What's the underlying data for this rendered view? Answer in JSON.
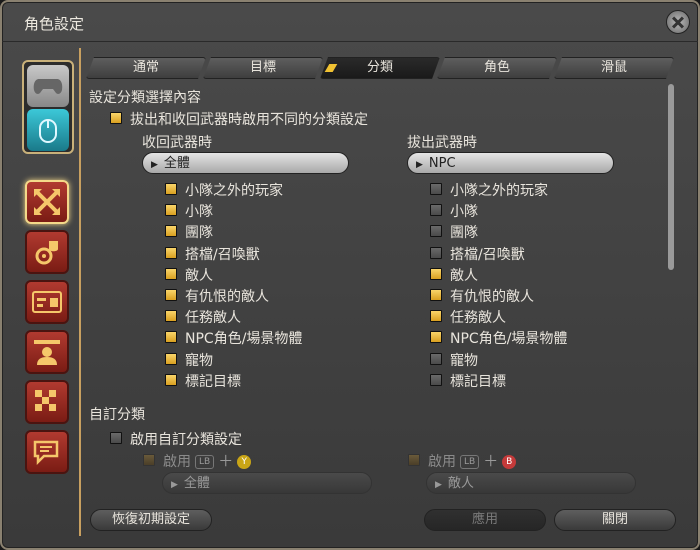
{
  "window": {
    "title": "角色設定"
  },
  "tabs": [
    {
      "label": "通常",
      "active": false
    },
    {
      "label": "目標",
      "active": false
    },
    {
      "label": "分類",
      "active": true
    },
    {
      "label": "角色",
      "active": false
    },
    {
      "label": "滑鼠",
      "active": false
    }
  ],
  "sidebar": {
    "modes": [
      "gamepad-icon",
      "mouse-icon"
    ],
    "categories": [
      "crossed-swords-icon",
      "gear-pouch-icon",
      "id-card-icon",
      "person-icon",
      "checker-icon",
      "chat-bubble-icon"
    ]
  },
  "section1": {
    "heading": "設定分類選擇內容",
    "toggle_label": "拔出和收回武器時啟用不同的分類設定",
    "toggle_checked": true,
    "left": {
      "header": "收回武器時",
      "dropdown": "全體",
      "items": [
        {
          "label": "小隊之外的玩家",
          "checked": true
        },
        {
          "label": "小隊",
          "checked": true
        },
        {
          "label": "團隊",
          "checked": true
        },
        {
          "label": "搭檔/召喚獸",
          "checked": true
        },
        {
          "label": "敵人",
          "checked": true
        },
        {
          "label": "有仇恨的敵人",
          "checked": true
        },
        {
          "label": "任務敵人",
          "checked": true
        },
        {
          "label": "NPC角色/場景物體",
          "checked": true
        },
        {
          "label": "寵物",
          "checked": true
        },
        {
          "label": "標記目標",
          "checked": true
        }
      ]
    },
    "right": {
      "header": "拔出武器時",
      "dropdown": "NPC",
      "items": [
        {
          "label": "小隊之外的玩家",
          "checked": false
        },
        {
          "label": "小隊",
          "checked": false
        },
        {
          "label": "團隊",
          "checked": false
        },
        {
          "label": "搭檔/召喚獸",
          "checked": false
        },
        {
          "label": "敵人",
          "checked": true
        },
        {
          "label": "有仇恨的敵人",
          "checked": true
        },
        {
          "label": "任務敵人",
          "checked": true
        },
        {
          "label": "NPC角色/場景物體",
          "checked": true
        },
        {
          "label": "寵物",
          "checked": false
        },
        {
          "label": "標記目標",
          "checked": false
        }
      ]
    }
  },
  "section2": {
    "heading": "自訂分類",
    "toggle_label": "啟用自訂分類設定",
    "toggle_checked": false,
    "left": {
      "enable_label": "啟用",
      "key": "LB",
      "button": "Y",
      "button_color": "#c9a516",
      "dropdown": "全體"
    },
    "right": {
      "enable_label": "啟用",
      "key": "LB",
      "button": "B",
      "button_color": "#c43a3a",
      "dropdown": "敵人"
    }
  },
  "footer": {
    "reset_label": "恢復初期設定",
    "apply_label": "應用",
    "close_label": "關閉"
  }
}
